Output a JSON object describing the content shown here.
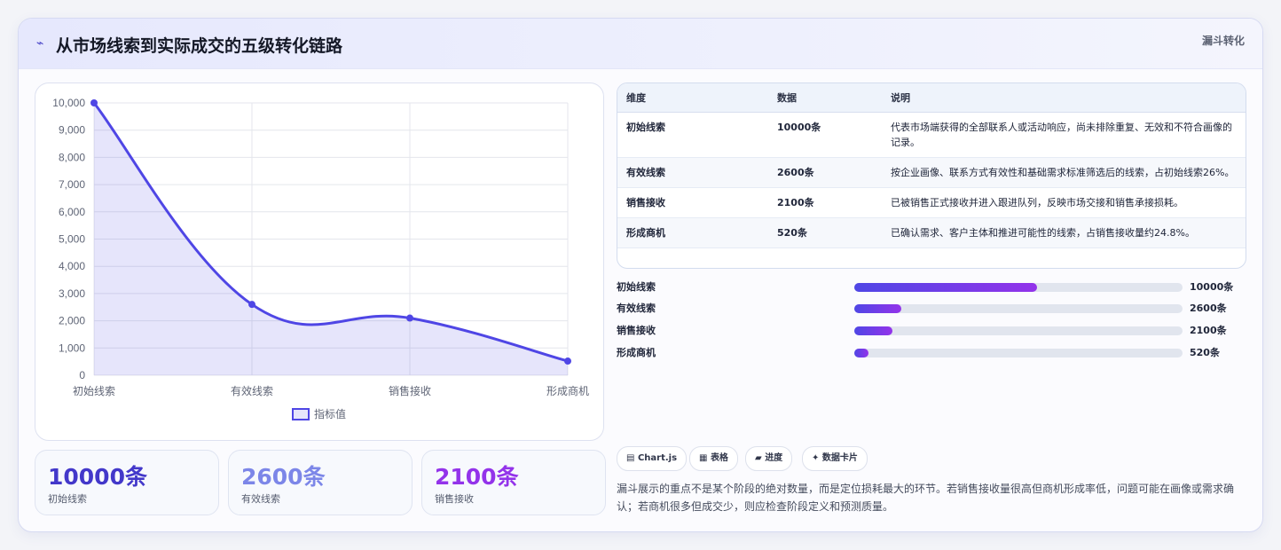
{
  "header": {
    "icon": "trend-line-icon",
    "title": "从市场线索到实际成交的五级转化链路",
    "tag": "漏斗转化"
  },
  "chart_data": {
    "type": "line",
    "categories": [
      "初始线索",
      "有效线索",
      "销售接收",
      "形成商机"
    ],
    "series": [
      {
        "name": "指标值",
        "values": [
          10000,
          2600,
          2100,
          520
        ],
        "color": "#4f46e5"
      }
    ],
    "ylim": [
      0,
      10000
    ],
    "yticks": [
      "10,000",
      "9,000",
      "8,000",
      "7,000",
      "6,000",
      "5,000",
      "4,000",
      "3,000",
      "2,000",
      "1,000",
      "0"
    ],
    "fill": true,
    "legend": "bottom"
  },
  "kpis": [
    {
      "value": "10000条",
      "label": "初始线索",
      "color": "#4338ca"
    },
    {
      "value": "2600条",
      "label": "有效线索",
      "color": "#7c86e8"
    },
    {
      "value": "2100条",
      "label": "销售接收",
      "color": "#9333ea"
    }
  ],
  "table": {
    "headers": [
      "维度",
      "数据",
      "说明"
    ],
    "rows": [
      [
        "初始线索",
        "10000条",
        "代表市场端获得的全部联系人或活动响应，尚未排除重复、无效和不符合画像的记录。"
      ],
      [
        "有效线索",
        "2600条",
        "按企业画像、联系方式有效性和基础需求标准筛选后的线索，占初始线索26%。"
      ],
      [
        "销售接收",
        "2100条",
        "已被销售正式接收并进入跟进队列，反映市场交接和销售承接损耗。"
      ],
      [
        "形成商机",
        "520条",
        "已确认需求、客户主体和推进可能性的线索，占销售接收量约24.8%。"
      ]
    ]
  },
  "progress": [
    {
      "label": "初始线索",
      "value": "10000条",
      "fraction": 0.556
    },
    {
      "label": "有效线索",
      "value": "2600条",
      "fraction": 0.144
    },
    {
      "label": "销售接收",
      "value": "2100条",
      "fraction": 0.117
    },
    {
      "label": "形成商机",
      "value": "520条",
      "fraction": 0.042
    }
  ],
  "chips": [
    {
      "icon": "chart-icon",
      "glyph": "▤",
      "label": "Chart.js"
    },
    {
      "icon": "table-icon",
      "glyph": "▦",
      "label": "表格"
    },
    {
      "icon": "progress-icon",
      "glyph": "▰",
      "label": "进度"
    },
    {
      "icon": "sparkle-icon",
      "glyph": "✦",
      "label": "数据卡片"
    }
  ],
  "footnote": "漏斗展示的重点不是某个阶段的绝对数量，而是定位损耗最大的环节。若销售接收量很高但商机形成率低，问题可能在画像或需求确认；若商机很多但成交少，则应检查阶段定义和预测质量。"
}
